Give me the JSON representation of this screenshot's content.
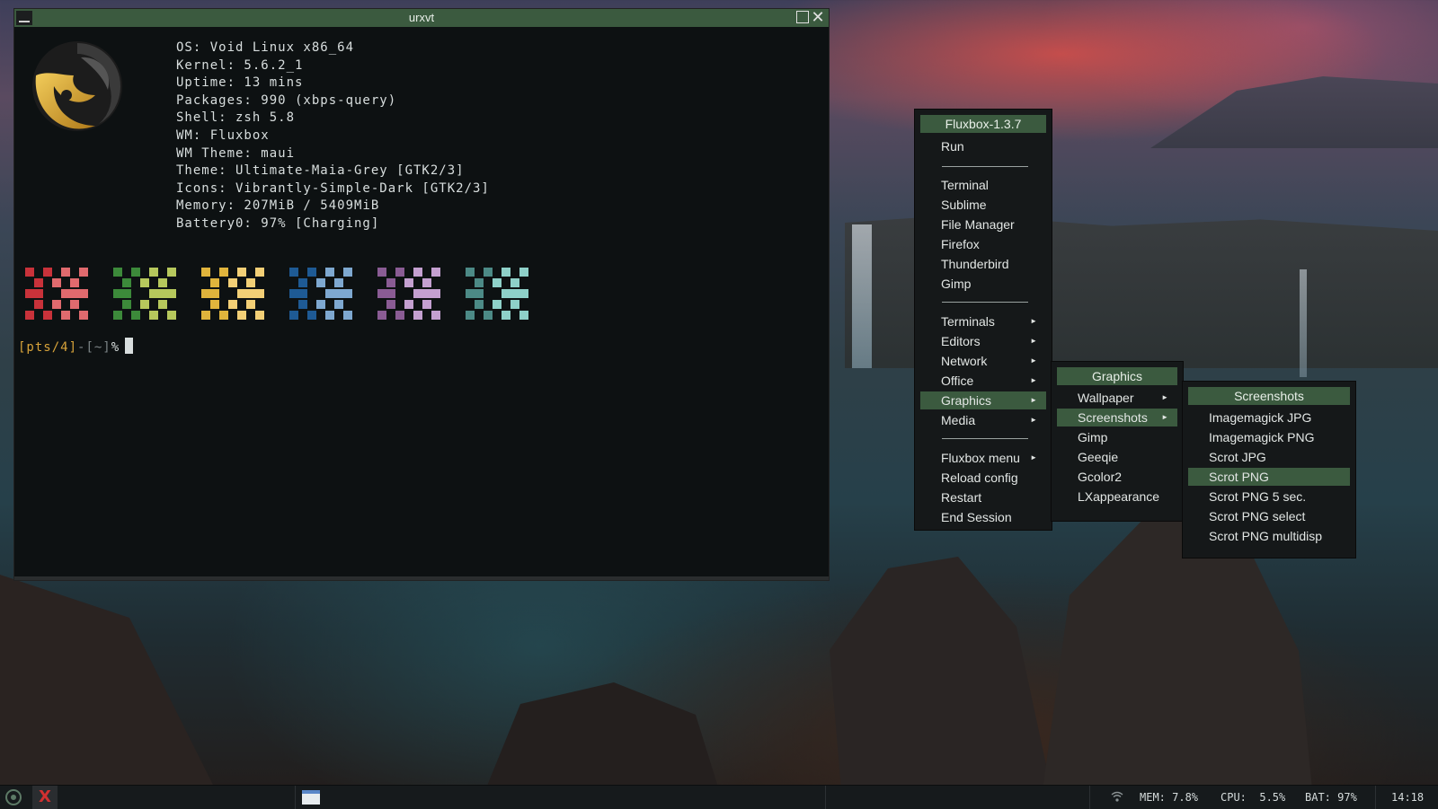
{
  "terminal": {
    "title": "urxvt",
    "info": [
      "OS: Void Linux x86_64",
      "Kernel: 5.6.2_1",
      "Uptime: 13 mins",
      "Packages: 990 (xbps-query)",
      "Shell: zsh 5.8",
      "WM: Fluxbox",
      "WM Theme: maui",
      "Theme: Ultimate-Maia-Grey [GTK2/3]",
      "Icons: Vibrantly-Simple-Dark [GTK2/3]",
      "Memory: 207MiB / 5409MiB",
      "Battery0: 97% [Charging]"
    ],
    "prompt": {
      "tty": "[pts/4]",
      "dash": "-",
      "cwd": "[~]",
      "symbol": "%"
    },
    "palette": [
      {
        "dark": "#c8323a",
        "light": "#e06a6e"
      },
      {
        "dark": "#3c8a3a",
        "light": "#b6c85c"
      },
      {
        "dark": "#e0b43c",
        "light": "#f2cf76"
      },
      {
        "dark": "#1e5a94",
        "light": "#7ea8d0"
      },
      {
        "dark": "#8a5c94",
        "light": "#c4a0d0"
      },
      {
        "dark": "#4c8a86",
        "light": "#8ed0c8"
      }
    ]
  },
  "root_menu": {
    "title": "Fluxbox-1.3.7",
    "run": "Run",
    "apps": [
      "Terminal",
      "Sublime",
      "File Manager",
      "Firefox",
      "Thunderbird",
      "Gimp"
    ],
    "submenus": [
      "Terminals",
      "Editors",
      "Network",
      "Office",
      "Graphics",
      "Media"
    ],
    "system": [
      "Fluxbox menu",
      "Reload config",
      "Restart",
      "End Session"
    ],
    "selected": "Graphics"
  },
  "graphics_menu": {
    "title": "Graphics",
    "items": [
      "Wallpaper",
      "Screenshots",
      "Gimp",
      "Geeqie",
      "Gcolor2",
      "LXappearance"
    ],
    "selected": "Screenshots"
  },
  "screenshots_menu": {
    "title": "Screenshots",
    "items": [
      "Imagemagick JPG",
      "Imagemagick PNG",
      "Scrot JPG",
      "Scrot PNG",
      "Scrot PNG 5 sec.",
      "Scrot PNG select",
      "Scrot PNG multidisp"
    ],
    "selected": "Scrot PNG"
  },
  "taskbar": {
    "mem": "MEM: 7.8%",
    "cpu": "CPU:  5.5%",
    "bat": "BAT: 97%",
    "clock": "14:18"
  }
}
